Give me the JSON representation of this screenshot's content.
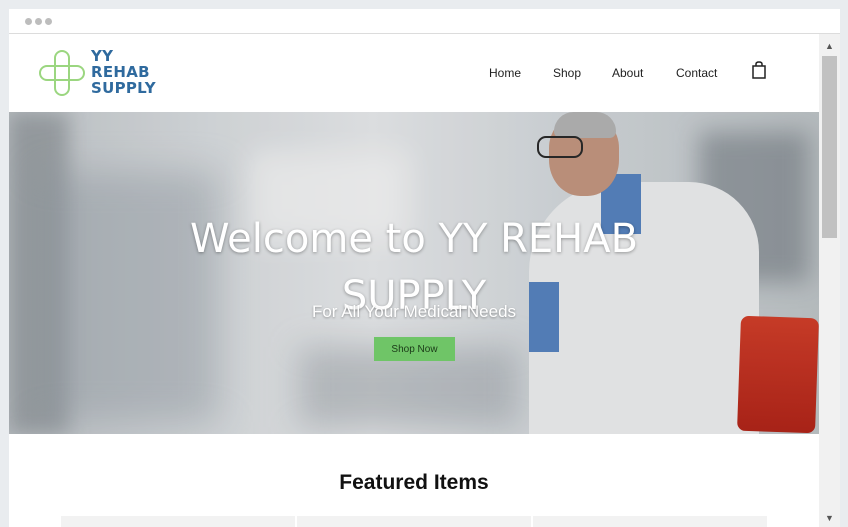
{
  "logo": {
    "line1": "YY",
    "line2": "REHAB",
    "line3": "SUPPLY",
    "mark_color": "#9bd680",
    "text_color": "#2f6a9e"
  },
  "nav": {
    "items": [
      {
        "label": "Home"
      },
      {
        "label": "Shop"
      },
      {
        "label": "About"
      },
      {
        "label": "Contact"
      }
    ],
    "cart_icon": "shopping-bag-icon"
  },
  "hero": {
    "title_line1": "Welcome to YY REHAB",
    "title_line2": "SUPPLY",
    "subtitle": "For All Your Medical Needs",
    "cta_label": "Shop Now",
    "cta_color": "#6fc567"
  },
  "featured": {
    "title": "Featured Items"
  },
  "browser": {
    "scroll_up": "▲",
    "scroll_down": "▼"
  }
}
